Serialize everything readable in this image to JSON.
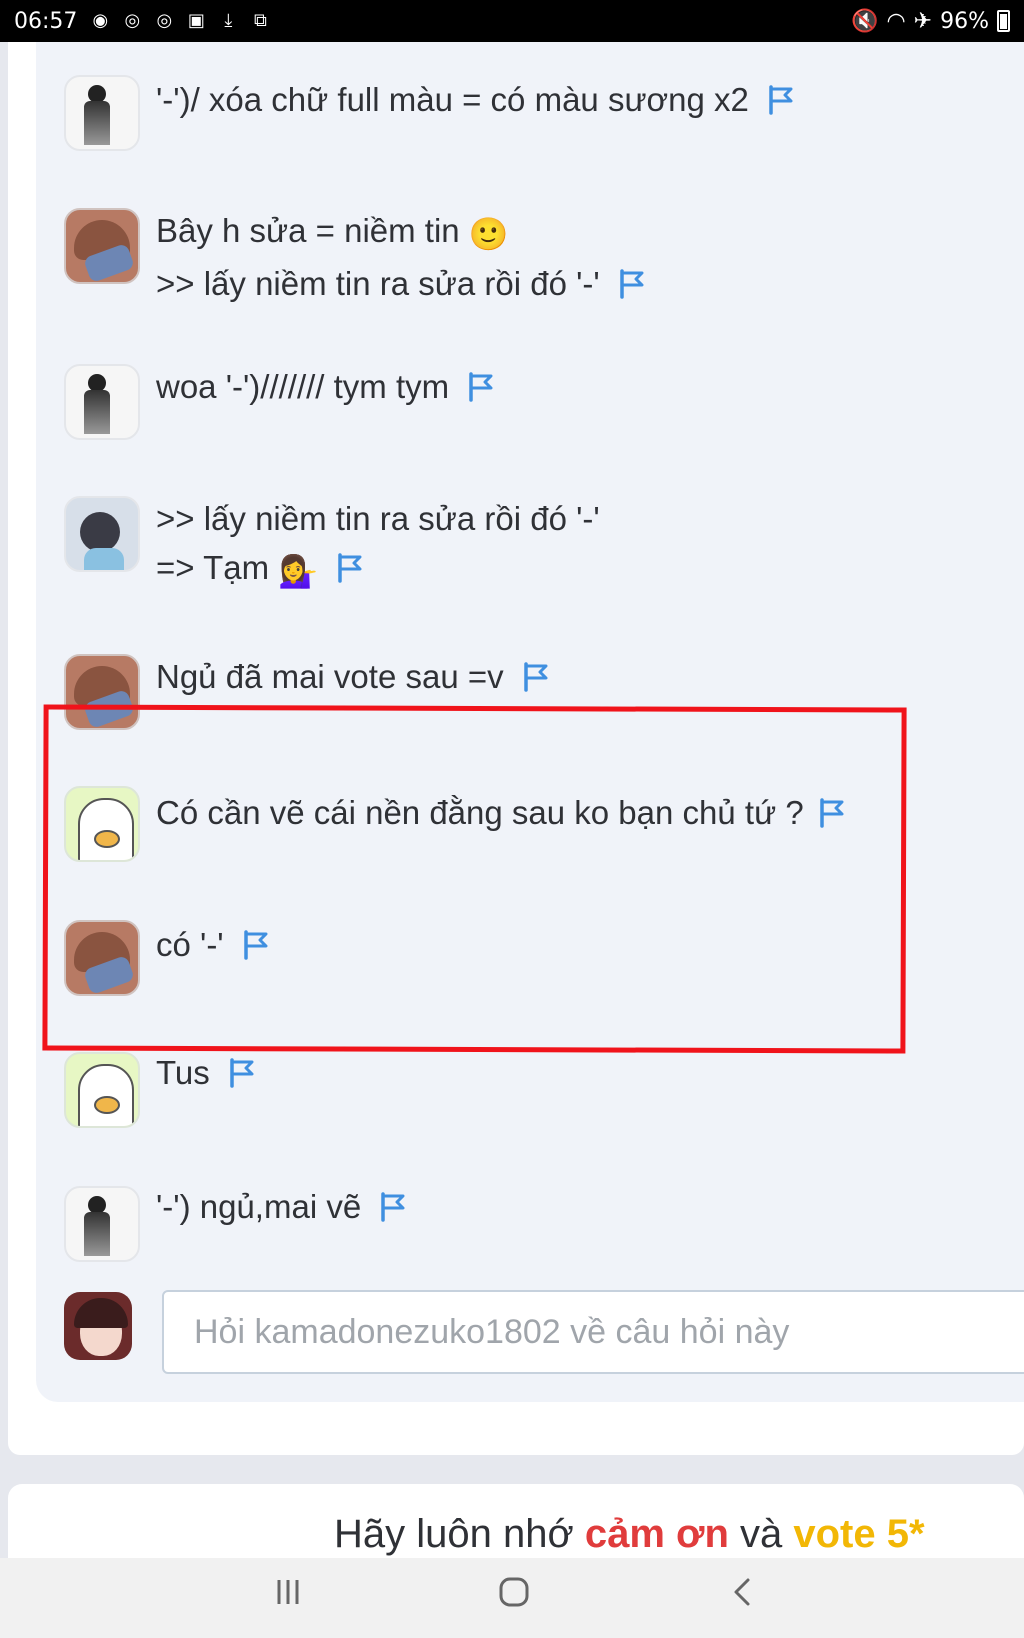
{
  "status_bar": {
    "time": "06:57",
    "notification_icons": [
      "messenger-icon",
      "chrome-icon",
      "chrome-icon",
      "screenshot-icon",
      "download-done-icon",
      "translate-icon"
    ],
    "battery": "96%"
  },
  "comments": [
    {
      "avatar": "bw",
      "lines": [
        "'-')/ xóa chữ full màu = có màu sương x2"
      ]
    },
    {
      "avatar": "brown",
      "lines": [
        "Bây h sửa = niềm tin",
        ">> lấy niềm tin ra sửa rồi đó '-'"
      ],
      "emoji": "🙂"
    },
    {
      "avatar": "bw",
      "lines": [
        "woa '-')/////// tym tym"
      ]
    },
    {
      "avatar": "girl",
      "lines": [
        ">> lấy niềm tin ra sửa rồi đó '-'",
        "=> Tạm"
      ],
      "emoji": "💁‍♀️"
    },
    {
      "avatar": "brown",
      "lines": [
        "Ngủ đã mai vote sau =v"
      ]
    },
    {
      "avatar": "duck",
      "lines": [
        "Có cần vẽ cái nền đằng sau ko bạn chủ tứ ?"
      ]
    },
    {
      "avatar": "brown",
      "lines": [
        "có '-'"
      ]
    },
    {
      "avatar": "duck",
      "lines": [
        "Tus"
      ]
    },
    {
      "avatar": "bw",
      "lines": [
        "'-') ngủ,mai vẽ"
      ]
    }
  ],
  "ask": {
    "placeholder": "Hỏi kamadonezuko1802 về câu hỏi này"
  },
  "footer": {
    "part1": "Hãy luôn nhớ ",
    "part2": "cảm ơn",
    "part3": " và ",
    "part4": "vote 5*"
  },
  "colors": {
    "flag": "#3f8fe0",
    "highlight": "#f0131b",
    "thanks_red": "#e03c3c",
    "thanks_yellow": "#f2b705"
  }
}
